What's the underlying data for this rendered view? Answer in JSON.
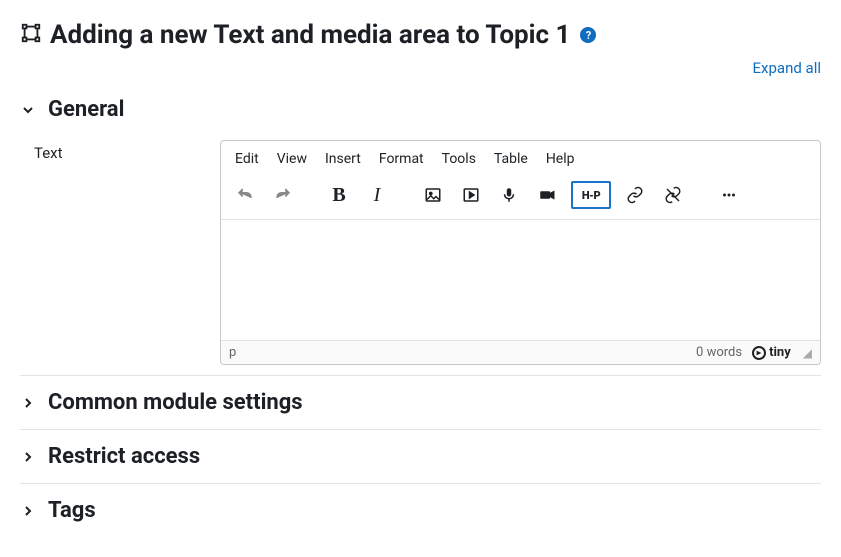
{
  "header": {
    "title": "Adding a new Text and media area to Topic 1",
    "help": "?"
  },
  "expand_all": "Expand all",
  "sections": {
    "general": {
      "title": "General",
      "field_label": "Text"
    },
    "common": {
      "title": "Common module settings"
    },
    "restrict": {
      "title": "Restrict access"
    },
    "tags": {
      "title": "Tags"
    }
  },
  "editor": {
    "menus": {
      "edit": "Edit",
      "view": "View",
      "insert": "Insert",
      "format": "Format",
      "tools": "Tools",
      "table": "Table",
      "help": "Help"
    },
    "h5p_label": "H-P",
    "status_path": "p",
    "word_count": "0 words",
    "brand": "tiny"
  }
}
